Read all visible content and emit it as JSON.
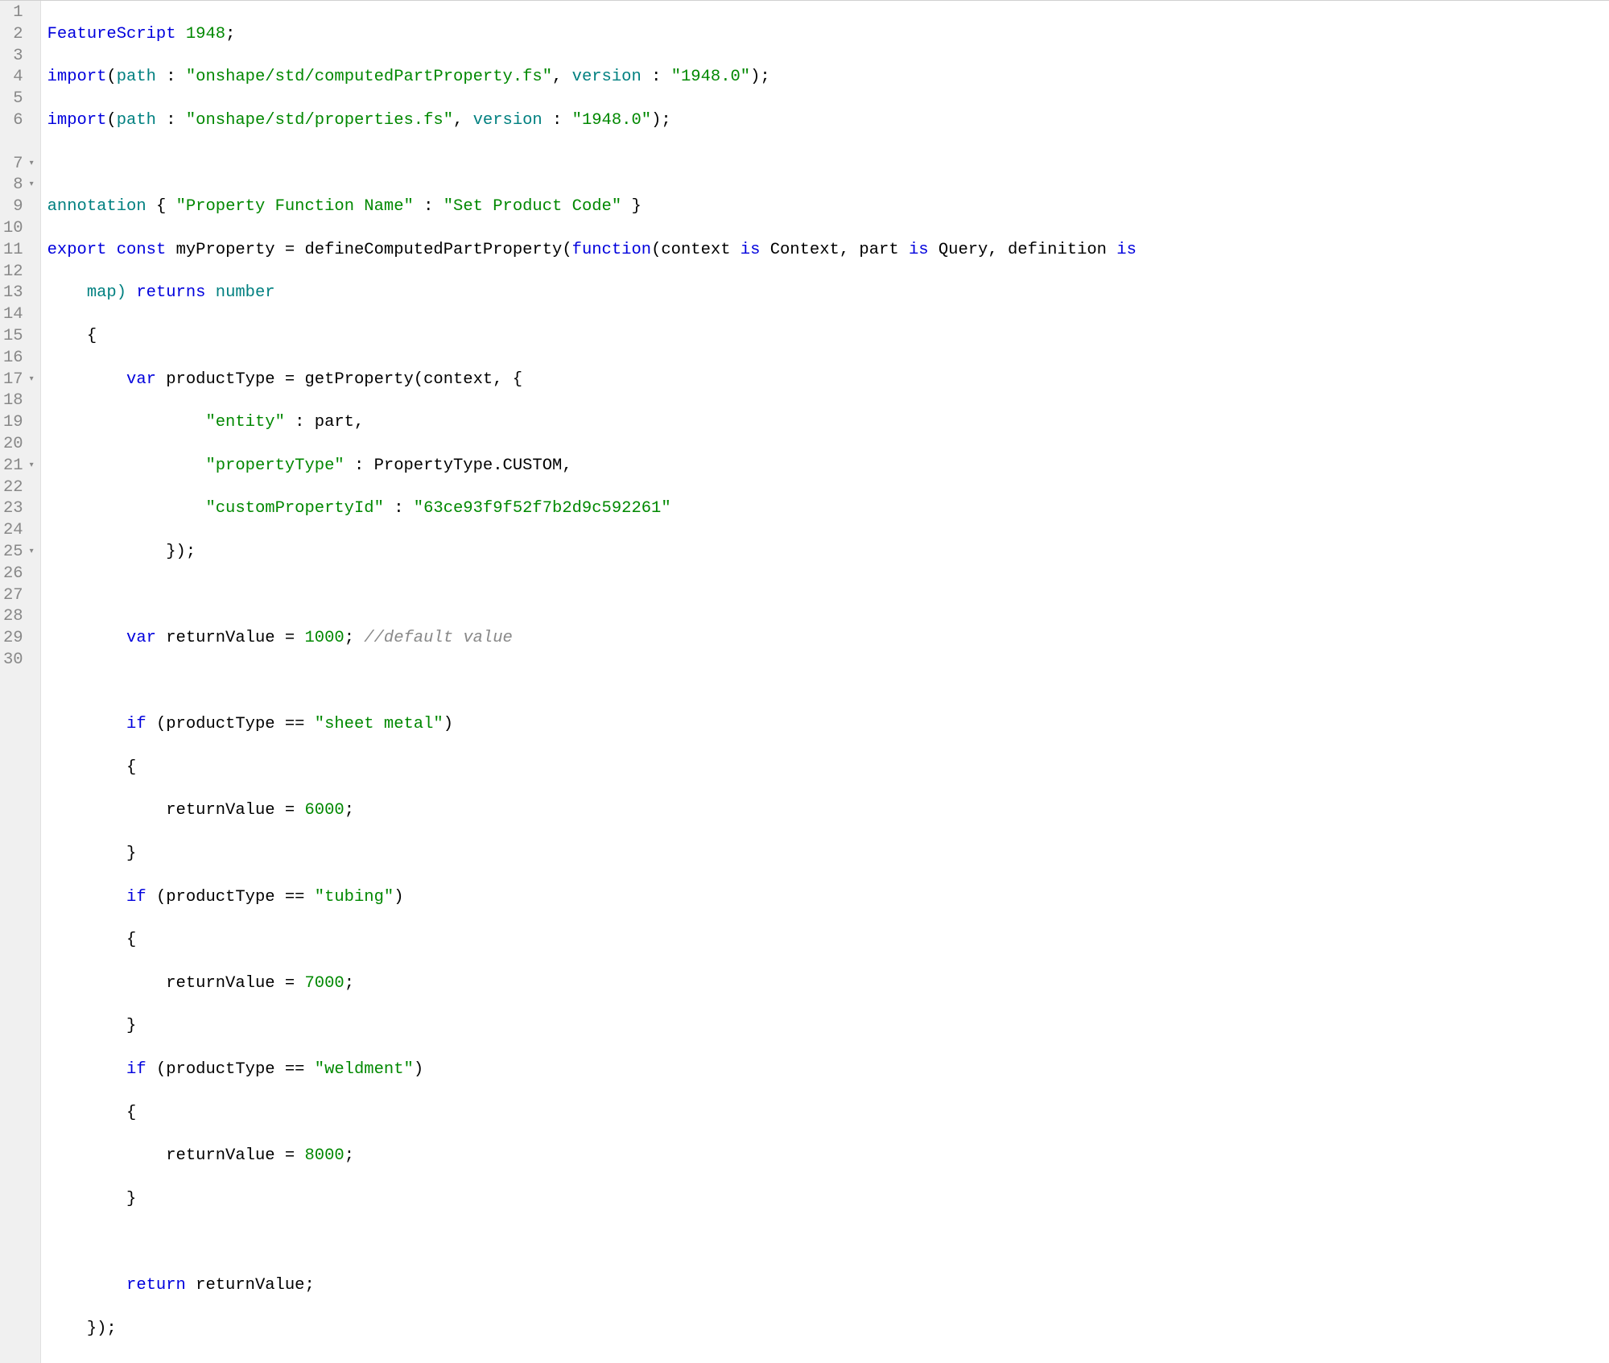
{
  "gutter": {
    "lines": [
      {
        "n": "1",
        "fold": ""
      },
      {
        "n": "2",
        "fold": ""
      },
      {
        "n": "3",
        "fold": ""
      },
      {
        "n": "4",
        "fold": ""
      },
      {
        "n": "5",
        "fold": ""
      },
      {
        "n": "6",
        "fold": ""
      },
      {
        "n": "7",
        "fold": "▾"
      },
      {
        "n": "8",
        "fold": "▾"
      },
      {
        "n": "9",
        "fold": ""
      },
      {
        "n": "10",
        "fold": ""
      },
      {
        "n": "11",
        "fold": ""
      },
      {
        "n": "12",
        "fold": ""
      },
      {
        "n": "13",
        "fold": ""
      },
      {
        "n": "14",
        "fold": ""
      },
      {
        "n": "15",
        "fold": ""
      },
      {
        "n": "16",
        "fold": ""
      },
      {
        "n": "17",
        "fold": "▾"
      },
      {
        "n": "18",
        "fold": ""
      },
      {
        "n": "19",
        "fold": ""
      },
      {
        "n": "20",
        "fold": ""
      },
      {
        "n": "21",
        "fold": "▾"
      },
      {
        "n": "22",
        "fold": ""
      },
      {
        "n": "23",
        "fold": ""
      },
      {
        "n": "24",
        "fold": ""
      },
      {
        "n": "25",
        "fold": "▾"
      },
      {
        "n": "26",
        "fold": ""
      },
      {
        "n": "27",
        "fold": ""
      },
      {
        "n": "28",
        "fold": ""
      },
      {
        "n": "29",
        "fold": ""
      },
      {
        "n": "30",
        "fold": ""
      }
    ]
  },
  "code": {
    "l1": {
      "featurescript": "FeatureScript",
      "ver": "1948",
      "semi": ";"
    },
    "l2": {
      "import": "import",
      "lp": "(",
      "path": "path",
      "colon": " : ",
      "str": "\"onshape/std/computedPartProperty.fs\"",
      "comma": ", ",
      "version": "version",
      "colon2": " : ",
      "str2": "\"1948.0\"",
      "rp": ");"
    },
    "l3": {
      "import": "import",
      "lp": "(",
      "path": "path",
      "colon": " : ",
      "str": "\"onshape/std/properties.fs\"",
      "comma": ", ",
      "version": "version",
      "colon2": " : ",
      "str2": "\"1948.0\"",
      "rp": ");"
    },
    "l5": {
      "annotation": "annotation",
      "space": " ",
      "lb": "{ ",
      "key": "\"Property Function Name\"",
      "colon": " : ",
      "val": "\"Set Product Code\"",
      "rb": " }"
    },
    "l6": {
      "export": "export",
      "sp1": " ",
      "const": "const",
      "sp2": " ",
      "name": "myProperty = defineComputedPartProperty(",
      "function": "function",
      "sig1": "(context ",
      "is1": "is",
      "sig2": " Context, part ",
      "is2": "is",
      "sig3": " Query, definition ",
      "is3": "is"
    },
    "l6b": {
      "sig4": "map) ",
      "returns": "returns",
      "sp": " ",
      "number": "number"
    },
    "l7": {
      "indent": "    ",
      "brace": "{"
    },
    "l8": {
      "indent": "        ",
      "var": "var",
      "rest": " productType = getProperty(context, {"
    },
    "l9": {
      "indent": "                ",
      "key": "\"entity\"",
      "rest": " : part,"
    },
    "l10": {
      "indent": "                ",
      "key": "\"propertyType\"",
      "rest": " : PropertyType.CUSTOM,"
    },
    "l11": {
      "indent": "                ",
      "key": "\"customPropertyId\"",
      "colon": " : ",
      "val": "\"63ce93f9f52f7b2d9c592261\""
    },
    "l12": {
      "indent": "            ",
      "close": "});"
    },
    "l14": {
      "indent": "        ",
      "var": "var",
      "rest": " returnValue = ",
      "num": "1000",
      "semi": "; ",
      "comment": "//default value"
    },
    "l16": {
      "indent": "        ",
      "if": "if",
      "rest": " (productType == ",
      "str": "\"sheet metal\"",
      "close": ")"
    },
    "l17": {
      "indent": "        ",
      "brace": "{"
    },
    "l18": {
      "indent": "            ",
      "rest": "returnValue = ",
      "num": "6000",
      "semi": ";"
    },
    "l19": {
      "indent": "        ",
      "brace": "}"
    },
    "l20": {
      "indent": "        ",
      "if": "if",
      "rest": " (productType == ",
      "str": "\"tubing\"",
      "close": ")"
    },
    "l21": {
      "indent": "        ",
      "brace": "{"
    },
    "l22": {
      "indent": "            ",
      "rest": "returnValue = ",
      "num": "7000",
      "semi": ";"
    },
    "l23": {
      "indent": "        ",
      "brace": "}"
    },
    "l24": {
      "indent": "        ",
      "if": "if",
      "rest": " (productType == ",
      "str": "\"weldment\"",
      "close": ")"
    },
    "l25": {
      "indent": "        ",
      "brace": "{"
    },
    "l26": {
      "indent": "            ",
      "rest": "returnValue = ",
      "num": "8000",
      "semi": ";"
    },
    "l27": {
      "indent": "        ",
      "brace": "}"
    },
    "l29": {
      "indent": "        ",
      "return": "return",
      "rest": " returnValue;"
    },
    "l30": {
      "indent": "    ",
      "close": "});"
    }
  }
}
